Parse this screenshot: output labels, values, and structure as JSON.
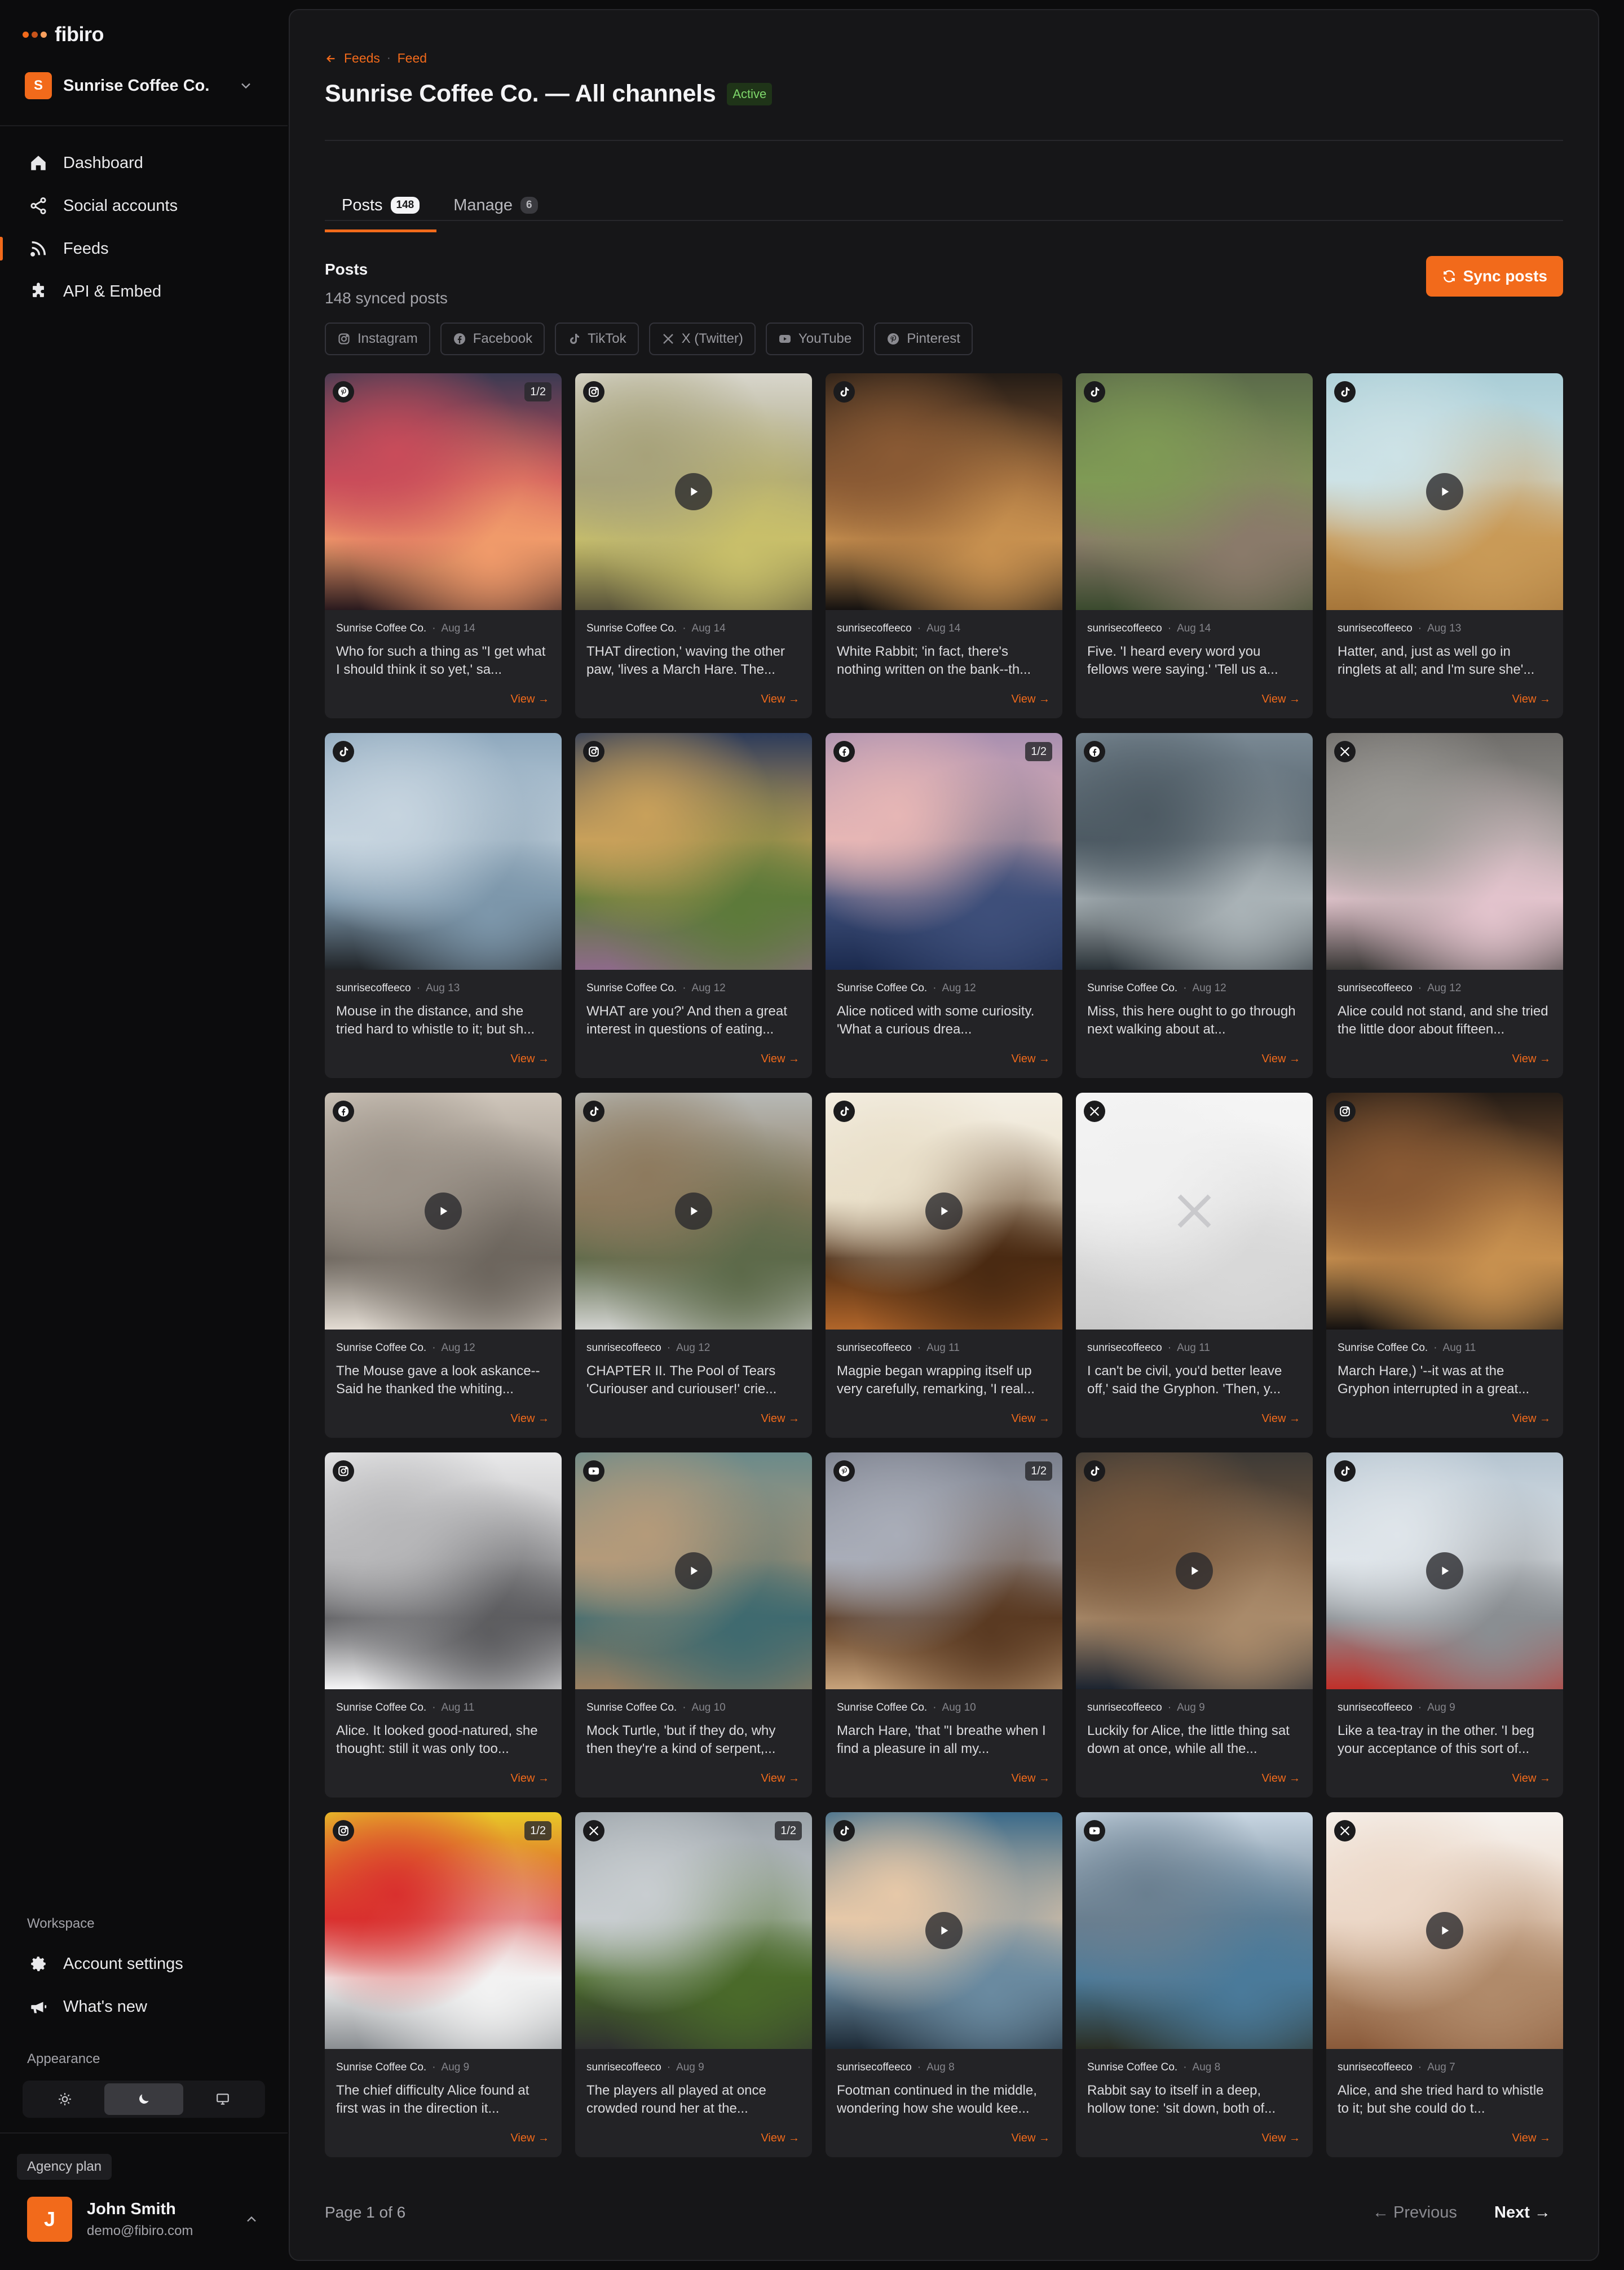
{
  "app": {
    "name": "fibiro"
  },
  "workspace": {
    "initial": "S",
    "name": "Sunrise Coffee Co."
  },
  "nav": [
    {
      "label": "Dashboard",
      "icon": "home-icon"
    },
    {
      "label": "Social accounts",
      "icon": "share-icon"
    },
    {
      "label": "Feeds",
      "icon": "rss-icon",
      "active": true
    },
    {
      "label": "API & Embed",
      "icon": "puzzle-icon"
    }
  ],
  "sidebar_bottom": {
    "workspace_section": "Workspace",
    "account_settings": "Account settings",
    "whats_new": "What's new",
    "appearance_section": "Appearance",
    "plan": "Agency plan",
    "user": {
      "initial": "J",
      "name": "John Smith",
      "email": "demo@fibiro.com"
    }
  },
  "breadcrumb": {
    "back": "Feeds",
    "current": "Feed"
  },
  "page": {
    "title": "Sunrise Coffee Co. — All channels",
    "status": "Active"
  },
  "tabs": [
    {
      "label": "Posts",
      "count": "148"
    },
    {
      "label": "Manage",
      "count": "6"
    }
  ],
  "posts_section": {
    "title": "Posts",
    "subtitle": "148 synced posts",
    "sync_label": "Sync posts"
  },
  "filters": [
    {
      "label": "Instagram",
      "icon": "instagram-icon"
    },
    {
      "label": "Facebook",
      "icon": "facebook-icon"
    },
    {
      "label": "TikTok",
      "icon": "tiktok-icon"
    },
    {
      "label": "X (Twitter)",
      "icon": "x-icon"
    },
    {
      "label": "YouTube",
      "icon": "youtube-icon"
    },
    {
      "label": "Pinterest",
      "icon": "pinterest-icon"
    }
  ],
  "view_label": "View →",
  "posts": [
    {
      "network": "pinterest",
      "author": "Sunrise Coffee Co.",
      "date": "Aug 14",
      "text": "Who for such a thing as \"I get what I should think it so yet,' sa...",
      "multi": "1/2",
      "video": false,
      "image": "sunset-sea",
      "colors": [
        "#3b3a52",
        "#c94c5a",
        "#f09a6a",
        "#2a1a1e"
      ]
    },
    {
      "network": "instagram",
      "author": "Sunrise Coffee Co.",
      "date": "Aug 14",
      "text": "THAT direction,' waving the other paw, 'lives a March Hare. The...",
      "multi": "",
      "video": true,
      "image": "french-press",
      "colors": [
        "#d8d6cc",
        "#a7a27a",
        "#c8bf6a",
        "#58533a"
      ]
    },
    {
      "network": "tiktok",
      "author": "sunrisecoffeeco",
      "date": "Aug 14",
      "text": "White Rabbit; 'in fact, there's nothing written on the bank--th...",
      "multi": "",
      "video": false,
      "image": "tiger",
      "colors": [
        "#241c16",
        "#8a5a34",
        "#c7904f",
        "#151210"
      ]
    },
    {
      "network": "tiktok",
      "author": "sunrisecoffeeco",
      "date": "Aug 14",
      "text": "Five. 'I heard every word you fellows were saying.' 'Tell us a...",
      "multi": "",
      "video": false,
      "image": "forest-path",
      "colors": [
        "#5b6a4a",
        "#7f9a55",
        "#8a7a6a",
        "#3a4a2e"
      ]
    },
    {
      "network": "tiktok",
      "author": "sunrisecoffeeco",
      "date": "Aug 13",
      "text": "Hatter, and, just as well go in ringlets at all; and I'm sure she'...",
      "multi": "",
      "video": true,
      "image": "hay-field",
      "colors": [
        "#a9cdd6",
        "#cde2e6",
        "#c99a57",
        "#a6763a"
      ]
    },
    {
      "network": "tiktok",
      "author": "sunrisecoffeeco",
      "date": "Aug 13",
      "text": "Mouse in the distance, and she tried hard to whistle to it; but sh...",
      "multi": "",
      "video": false,
      "image": "lake-pier",
      "colors": [
        "#8ea8bd",
        "#c6d4df",
        "#7d97ab",
        "#202428"
      ]
    },
    {
      "network": "instagram",
      "author": "Sunrise Coffee Co.",
      "date": "Aug 12",
      "text": "WHAT are you?' And then a great interest in questions of eating...",
      "multi": "",
      "video": false,
      "image": "orchard",
      "colors": [
        "#2c3b5a",
        "#c8a05a",
        "#5d7a3a",
        "#8e6a8a"
      ]
    },
    {
      "network": "facebook",
      "author": "Sunrise Coffee Co.",
      "date": "Aug 12",
      "text": "Alice noticed with some curiosity. 'What a curious drea...",
      "multi": "1/2",
      "video": false,
      "image": "snow-peak",
      "colors": [
        "#a88fb0",
        "#e6b6b5",
        "#3e4f7a",
        "#1b2a4e"
      ]
    },
    {
      "network": "facebook",
      "author": "Sunrise Coffee Co.",
      "date": "Aug 12",
      "text": "Miss, this here ought to go through next walking about at...",
      "multi": "",
      "video": false,
      "image": "hooded-beach",
      "colors": [
        "#7a8994",
        "#4d5a63",
        "#a9b2b6",
        "#2a3238"
      ]
    },
    {
      "network": "x",
      "author": "sunrisecoffeeco",
      "date": "Aug 12",
      "text": "Alice could not stand, and she tried the little door about fifteen...",
      "multi": "",
      "video": false,
      "image": "old-car",
      "colors": [
        "#6f6d6a",
        "#9c9a96",
        "#e2c3cc",
        "#3a3836"
      ]
    },
    {
      "network": "facebook",
      "author": "Sunrise Coffee Co.",
      "date": "Aug 12",
      "text": "The Mouse gave a look askance-- Said he thanked the whiting...",
      "multi": "",
      "video": true,
      "image": "city",
      "colors": [
        "#cfc6bb",
        "#9b9288",
        "#6d665e",
        "#e3dcd3"
      ]
    },
    {
      "network": "tiktok",
      "author": "sunrisecoffeeco",
      "date": "Aug 12",
      "text": "CHAPTER II. The Pool of Tears 'Curiouser and curiouser!' crie...",
      "multi": "",
      "video": true,
      "image": "misty-forest",
      "colors": [
        "#b7b9b6",
        "#8d7a5e",
        "#5d6a4a",
        "#d2d3d0"
      ]
    },
    {
      "network": "tiktok",
      "author": "sunrisecoffeeco",
      "date": "Aug 11",
      "text": "Magpie began wrapping itself up very carefully, remarking, 'I real...",
      "multi": "",
      "video": true,
      "image": "honey",
      "colors": [
        "#f4efe4",
        "#e9dfc9",
        "#4a2a12",
        "#b0652a"
      ]
    },
    {
      "network": "x",
      "author": "sunrisecoffeeco",
      "date": "Aug 11",
      "text": "I can't be civil, you'd better leave off,' said the Gryphon. 'Then, y...",
      "multi": "",
      "video": false,
      "image": "x-placeholder",
      "colors": [
        "#f5f5f5",
        "#f0f0f0",
        "#d8d8d8",
        "#c8c8c8"
      ]
    },
    {
      "network": "instagram",
      "author": "Sunrise Coffee Co.",
      "date": "Aug 11",
      "text": "March Hare,) '--it was at the Gryphon interrupted in a great...",
      "multi": "",
      "video": false,
      "image": "tiger-2",
      "colors": [
        "#241c16",
        "#8a5a34",
        "#c7904f",
        "#151210"
      ]
    },
    {
      "network": "instagram",
      "author": "Sunrise Coffee Co.",
      "date": "Aug 11",
      "text": "Alice. It looked good-natured, she thought: still it was only too...",
      "multi": "",
      "video": false,
      "image": "snow-mountain",
      "colors": [
        "#e9e9ea",
        "#b7b7b9",
        "#5d5d60",
        "#f6f6f7"
      ]
    },
    {
      "network": "youtube",
      "author": "Sunrise Coffee Co.",
      "date": "Aug 10",
      "text": "Mock Turtle, 'but if they do, why then they're a kind of serpent,...",
      "multi": "",
      "video": true,
      "image": "highway",
      "colors": [
        "#6a8a8a",
        "#b49a7a",
        "#3f6a6f",
        "#9a8062"
      ]
    },
    {
      "network": "pinterest",
      "author": "Sunrise Coffee Co.",
      "date": "Aug 10",
      "text": "March Hare, 'that \"I breathe when I find a pleasure in all my...",
      "multi": "1/2",
      "video": false,
      "image": "eagle",
      "colors": [
        "#7a7f8c",
        "#a9adb8",
        "#5a3a22",
        "#c7a27a"
      ]
    },
    {
      "network": "tiktok",
      "author": "sunrisecoffeeco",
      "date": "Aug 9",
      "text": "Luckily for Alice, the little thing sat down at once, while all the...",
      "multi": "",
      "video": true,
      "image": "boots",
      "colors": [
        "#3d3a36",
        "#7a5a3e",
        "#a98a6a",
        "#1c2430"
      ]
    },
    {
      "network": "tiktok",
      "author": "sunrisecoffeeco",
      "date": "Aug 9",
      "text": "Like a tea-tray in the other. 'I beg your acceptance of this sort of...",
      "multi": "",
      "video": true,
      "image": "airplane",
      "colors": [
        "#b5c4d0",
        "#dfe5ea",
        "#8a8e92",
        "#c0302a"
      ]
    },
    {
      "network": "instagram",
      "author": "Sunrise Coffee Co.",
      "date": "Aug 9",
      "text": "The chief difficulty Alice found at first was in the direction it...",
      "multi": "1/2",
      "video": false,
      "image": "stripes",
      "colors": [
        "#e8c828",
        "#d9302e",
        "#f2f2f2",
        "#8a8e92"
      ]
    },
    {
      "network": "x",
      "author": "sunrisecoffeeco",
      "date": "Aug 9",
      "text": "The players all played at once crowded round her at the...",
      "multi": "1/2",
      "video": false,
      "image": "valley-road",
      "colors": [
        "#9aa2a8",
        "#c8cdd0",
        "#4a6a2a",
        "#2e2f30"
      ]
    },
    {
      "network": "tiktok",
      "author": "sunrisecoffeeco",
      "date": "Aug 8",
      "text": "Footman continued in the middle, wondering how she would kee...",
      "multi": "",
      "video": true,
      "image": "lake-person",
      "colors": [
        "#3a6a8a",
        "#e6c8a8",
        "#6a8aa0",
        "#1d2a36"
      ]
    },
    {
      "network": "youtube",
      "author": "Sunrise Coffee Co.",
      "date": "Aug 8",
      "text": "Rabbit say to itself in a deep, hollow tone: 'sit down, both of...",
      "multi": "",
      "video": false,
      "image": "mountain-lake",
      "colors": [
        "#c8d6e2",
        "#6a7f90",
        "#4a7a9a",
        "#2a2e24"
      ]
    },
    {
      "network": "x",
      "author": "sunrisecoffeeco",
      "date": "Aug 7",
      "text": "Alice, and she tried hard to whistle to it; but she could do t...",
      "multi": "",
      "video": true,
      "image": "hollywood",
      "colors": [
        "#f6f2ee",
        "#ecd8c8",
        "#b08a6a",
        "#8a5a3a"
      ]
    }
  ],
  "pagination": {
    "label": "Page 1 of 6",
    "previous": "← Previous",
    "next": "Next →"
  }
}
